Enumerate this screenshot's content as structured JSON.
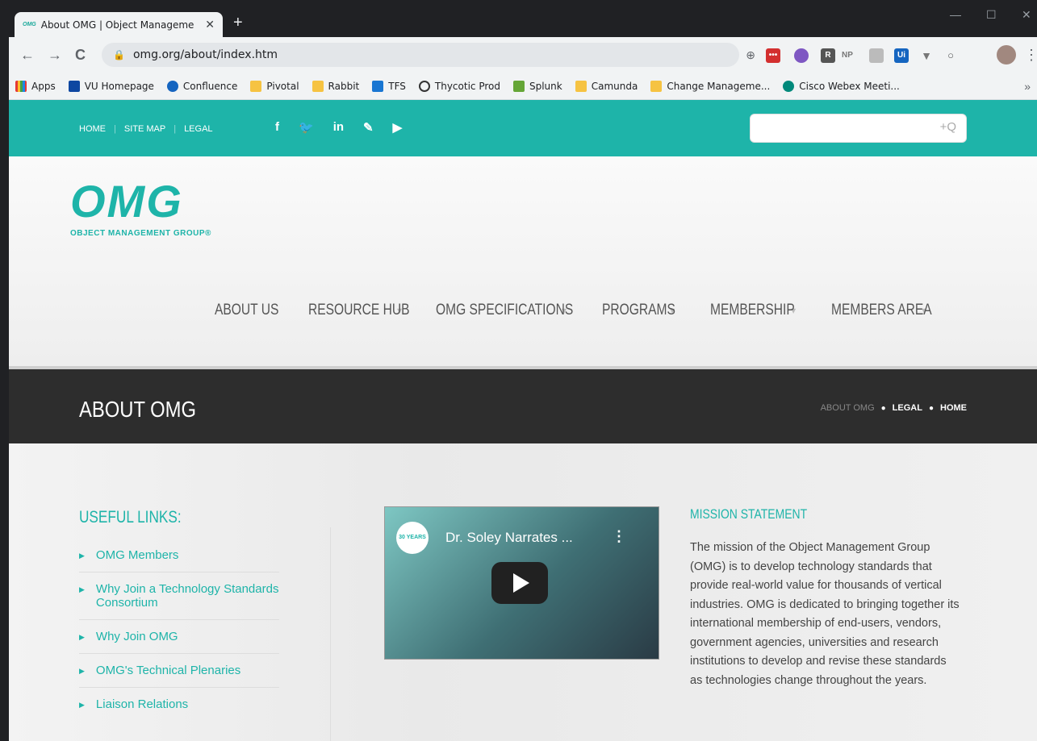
{
  "browser": {
    "tab_title": "About OMG | Object Manageme",
    "tab_favicon": "OMG",
    "url": "omg.org/about/index.htm",
    "extensions": [
      "NP",
      "Ui",
      "R"
    ],
    "bookmarks": [
      "Apps",
      "VU Homepage",
      "Confluence",
      "Pivotal",
      "Rabbit",
      "TFS",
      "Thycotic Prod",
      "Splunk",
      "Camunda",
      "Change Manageme...",
      "Cisco Webex Meeti..."
    ],
    "more_bookmarks": "»"
  },
  "site": {
    "top_links": [
      "HOME",
      "SITE MAP",
      "LEGAL"
    ],
    "social_icons": [
      "facebook-icon",
      "twitter-icon",
      "linkedin-icon",
      "edit-icon",
      "youtube-icon"
    ],
    "search_icon_glyph": "+Q",
    "logo_mark": "OMG",
    "logo_sub": "OBJECT MANAGEMENT GROUP®",
    "nav": [
      "ABOUT US",
      "RESOURCE HUB",
      "OMG SPECIFICATIONS",
      "PROGRAMS",
      "MEMBERSHIP",
      "MEMBERS AREA"
    ],
    "page_title": "ABOUT OMG",
    "breadcrumbs": [
      "ABOUT OMG",
      "LEGAL",
      "HOME"
    ]
  },
  "useful_links": {
    "title": "USEFUL LINKS:",
    "items": [
      "OMG Members",
      "Why Join a Technology Standards Consortium",
      "Why Join OMG",
      "OMG's Technical Plenaries",
      "Liaison Relations"
    ]
  },
  "video": {
    "title": "Dr. Soley Narrates ...",
    "badge": "30 YEARS"
  },
  "mission": {
    "title": "MISSION STATEMENT",
    "text": "The mission of the Object Management Group (OMG) is to develop technology standards that provide real-world value for thousands of vertical industries. OMG is dedicated to bringing together its international membership of end-users, vendors, government agencies, universities and research institutions to develop and revise these standards as technologies change throughout the years."
  },
  "colors": {
    "accent": "#1eb4a9",
    "titlebar": "#2d2d2d"
  }
}
